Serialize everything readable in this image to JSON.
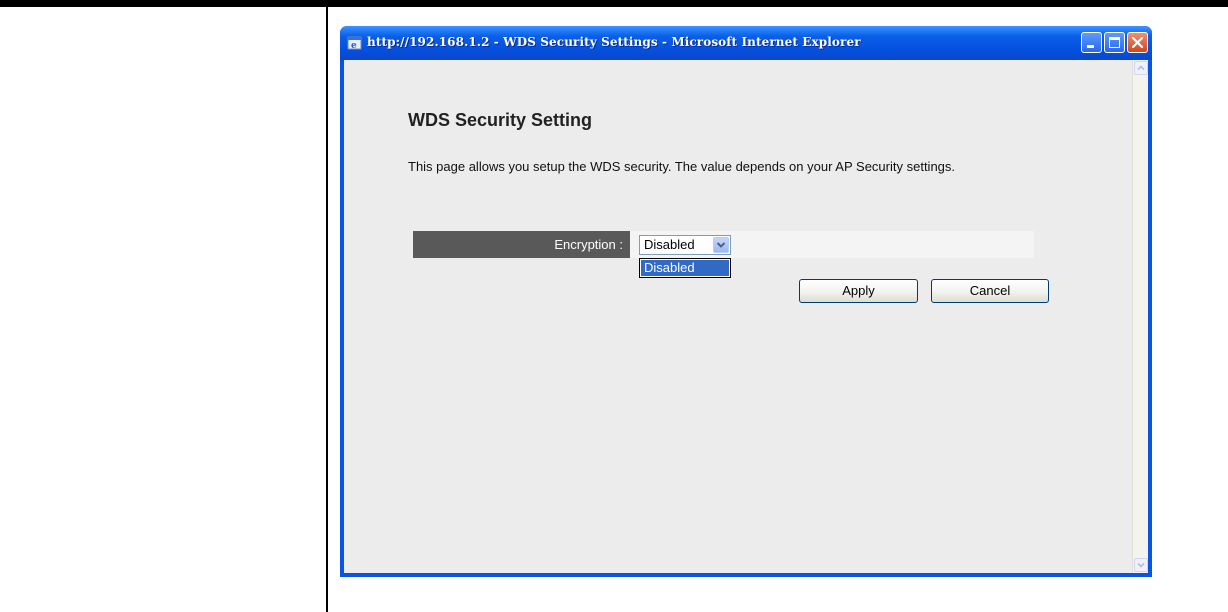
{
  "window": {
    "title": "http://192.168.1.2 - WDS Security Settings - Microsoft Internet Explorer",
    "controls": [
      "minimize-icon",
      "maximize-icon",
      "close-icon"
    ]
  },
  "page": {
    "heading": "WDS Security Setting",
    "description": "This page allows you setup the WDS security. The value depends on your AP Security settings."
  },
  "form": {
    "encryption_label": "Encryption :",
    "encryption_value": "Disabled",
    "encryption_options": [
      "Disabled"
    ]
  },
  "buttons": {
    "apply_label": "Apply",
    "cancel_label": "Cancel"
  },
  "colors": {
    "titlebar": "#0a5fe8",
    "label_cell": "#595959",
    "selected_option": "#316ac5"
  }
}
